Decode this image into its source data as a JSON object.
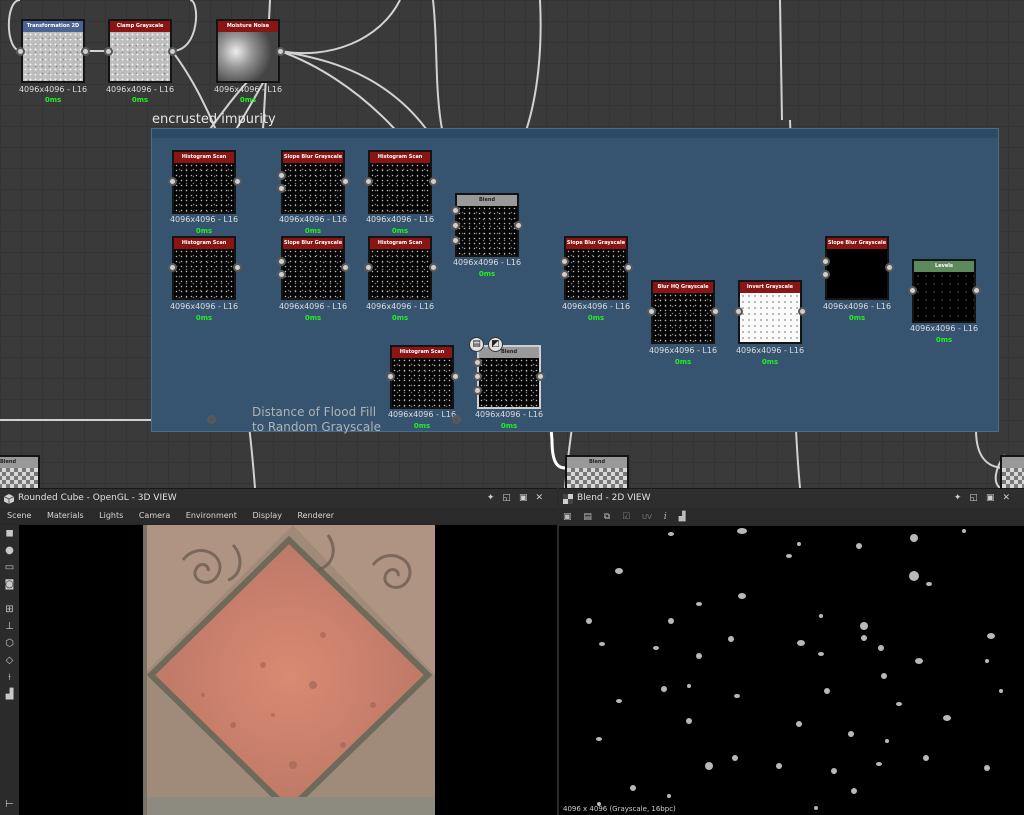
{
  "graph": {
    "frame_title": "encrusted impurity",
    "comment_lines": [
      "Distance of Flood Fill",
      "to Random Grayscale"
    ]
  },
  "nodes": {
    "transformation": {
      "title": "Transformation 2D",
      "res": "4096x4096 - L16",
      "ms": "0ms"
    },
    "clamp": {
      "title": "Clamp Grayscale",
      "res": "4096x4096 - L16",
      "ms": "0ms"
    },
    "moisture": {
      "title": "Moisture Noise",
      "res": "4096x4096 - L16",
      "ms": "0ms"
    },
    "hist1": {
      "title": "Histogram Scan",
      "res": "4096x4096 - L16",
      "ms": "0ms"
    },
    "slope1": {
      "title": "Slope Blur Grayscale",
      "res": "4096x4096 - L16",
      "ms": "0ms"
    },
    "hist2": {
      "title": "Histogram Scan",
      "res": "4096x4096 - L16",
      "ms": "0ms"
    },
    "blend1": {
      "title": "Blend",
      "res": "4096x4096 - L16",
      "ms": "0ms"
    },
    "hist3": {
      "title": "Histogram Scan",
      "res": "4096x4096 - L16",
      "ms": "0ms"
    },
    "slope2": {
      "title": "Slope Blur Grayscale",
      "res": "4096x4096 - L16",
      "ms": "0ms"
    },
    "hist4": {
      "title": "Histogram Scan",
      "res": "4096x4096 - L16",
      "ms": "0ms"
    },
    "slope3": {
      "title": "Slope Blur Grayscale",
      "res": "4096x4096 - L16",
      "ms": "0ms"
    },
    "blurhq": {
      "title": "Blur HQ Grayscale",
      "res": "4096x4096 - L16",
      "ms": "0ms"
    },
    "invert": {
      "title": "Invert Grayscale",
      "res": "4096x4096 - L16",
      "ms": "0ms"
    },
    "slope4": {
      "title": "Slope Blur Grayscale",
      "res": "4096x4096 - L16",
      "ms": "0ms"
    },
    "levels": {
      "title": "Levels",
      "res": "4096x4096 - L16",
      "ms": "0ms"
    },
    "hist5": {
      "title": "Histogram Scan",
      "res": "4096x4096 - L16",
      "ms": "0ms"
    },
    "blend2": {
      "title": "Blend",
      "res": "4096x4096 - L16",
      "ms": "0ms"
    },
    "blend_bl": {
      "title": "Blend"
    },
    "blend_bm": {
      "title": "Blend"
    }
  },
  "panel3d": {
    "title": "Rounded Cube - OpenGL - 3D VIEW",
    "menu": [
      "Scene",
      "Materials",
      "Lights",
      "Camera",
      "Environment",
      "Display",
      "Renderer"
    ]
  },
  "panel2d": {
    "title": "Blend - 2D VIEW",
    "uv_label": "UV",
    "status": "4096 x 4096 (Grayscale, 16bpc)"
  },
  "colors": {
    "frame": "#36546f",
    "node_header_red": "#8a1515",
    "node_header_blue": "#4a6390",
    "node_header_gray": "#999999",
    "node_header_green": "#5d8a5d",
    "timing_green": "#22ee22"
  },
  "icons": {
    "panel_buttons": [
      "pin-icon",
      "restore-icon",
      "maximize-icon",
      "close-icon"
    ],
    "viewport_sidebar": [
      "camera-icon",
      "light-icon",
      "environment-icon",
      "screenshot-icon",
      "grid-icon",
      "axis-icon",
      "cube-icon",
      "wireframe-icon",
      "gizmo-icon",
      "histogram-icon"
    ],
    "toolbar2d": [
      "save-icon",
      "export-icon",
      "copy-icon",
      "checker-icon",
      "uv-icon",
      "info-icon",
      "histogram-icon"
    ]
  }
}
